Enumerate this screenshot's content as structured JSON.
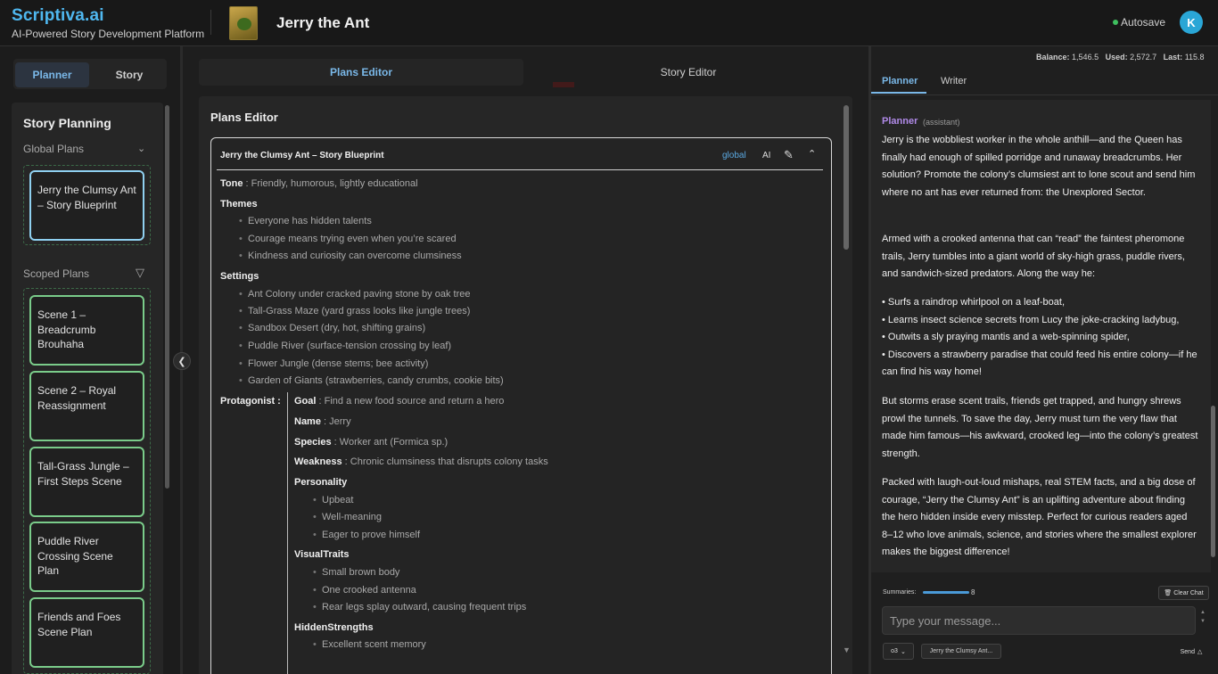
{
  "header": {
    "brand": "Scriptiva.ai",
    "tagline": "AI-Powered Story Development Platform",
    "story_title": "Jerry the Ant",
    "autosave": "Autosave",
    "avatar_initial": "K"
  },
  "left": {
    "tabs": [
      "Planner",
      "Story"
    ],
    "panel_title": "Story Planning",
    "global_label": "Global Plans",
    "global_plans": [
      "Jerry the Clumsy Ant – Story Blueprint"
    ],
    "scoped_label": "Scoped Plans",
    "scoped_plans": [
      "Scene 1 – Breadcrumb Brouhaha",
      "Scene 2 – Royal Reassignment",
      "Tall-Grass Jungle – First Steps Scene",
      "Puddle River Crossing Scene Plan",
      "Friends and Foes Scene Plan"
    ]
  },
  "middle": {
    "tabs": [
      "Plans Editor",
      "Story Editor"
    ],
    "panel_title": "Plans Editor",
    "doc": {
      "title": "Jerry the Clumsy Ant – Story Blueprint",
      "scope_badge": "global",
      "ai_label": "AI",
      "tone_key": "Tone",
      "tone_value": "Friendly, humorous, lightly educational",
      "themes_label": "Themes",
      "themes": [
        "Everyone has hidden talents",
        "Courage means trying even when you’re scared",
        "Kindness and curiosity can overcome clumsiness"
      ],
      "settings_label": "Settings",
      "settings": [
        "Ant Colony under cracked paving stone by oak tree",
        "Tall-Grass Maze (yard grass looks like jungle trees)",
        "Sandbox Desert (dry, hot, shifting grains)",
        "Puddle River (surface-tension crossing by leaf)",
        "Flower Jungle (dense stems; bee activity)",
        "Garden of Giants (strawberries, candy crumbs, cookie bits)"
      ],
      "protagonist_label": "Protagonist :",
      "goal_key": "Goal",
      "goal_value": "Find a new food source and return a hero",
      "name_key": "Name",
      "name_value": "Jerry",
      "species_key": "Species",
      "species_value": "Worker ant (Formica sp.)",
      "weakness_key": "Weakness",
      "weakness_value": "Chronic clumsiness that disrupts colony tasks",
      "personality_label": "Personality",
      "personality": [
        "Upbeat",
        "Well-meaning",
        "Eager to prove himself"
      ],
      "visual_label": "VisualTraits",
      "visual": [
        "Small brown body",
        "One crooked antenna",
        "Rear legs splay outward, causing frequent trips"
      ],
      "hidden_label": "HiddenStrengths",
      "hidden": [
        "Excellent scent memory"
      ]
    }
  },
  "right": {
    "stats": {
      "balance_label": "Balance:",
      "balance": "1,546.5",
      "used_label": "Used:",
      "used": "2,572.7",
      "last_label": "Last:",
      "last": "115.8"
    },
    "tabs": [
      "Planner",
      "Writer"
    ],
    "role": "Planner",
    "role_sub": "(assistant)",
    "paragraphs": [
      "Jerry is the wobbliest worker in the whole anthill—and the Queen has finally had enough of spilled porridge and runaway breadcrumbs. Her solution? Promote the colony’s clumsiest ant to lone scout and send him where no ant has ever returned from: the Unexplored Sector.",
      "Armed with a crooked antenna that can “read” the faintest pheromone trails, Jerry tumbles into a giant world of sky-high grass, puddle rivers, and sandwich-sized predators. Along the way he:",
      "• Surfs a raindrop whirlpool on a leaf-boat,\n• Learns insect science secrets from Lucy the joke-cracking ladybug,\n• Outwits a sly praying mantis and a web-spinning spider,\n• Discovers a strawberry paradise that could feed his entire colony—if he can find his way home!",
      "But storms erase scent trails, friends get trapped, and hungry shrews prowl the tunnels. To save the day, Jerry must turn the very flaw that made him famous—his awkward, crooked leg—into the colony’s greatest strength.",
      "Packed with laugh-out-loud mishaps, real STEM facts, and a big dose of courage, “Jerry the Clumsy Ant” is an uplifting adventure about finding the hero hidden inside every misstep. Perfect for curious readers aged 8–12 who love animals, science, and stories where the smallest explorer makes the biggest difference!"
    ],
    "summaries_label": "Summaries:",
    "summaries_value": "8",
    "clear_chat": "Clear Chat",
    "message_placeholder": "Type your message...",
    "model": "o3",
    "context_chip": "Jerry the Clumsy Ant...",
    "send": "Send"
  },
  "colors": {
    "accent": "#4fb8f0",
    "card_border": "#7acc8a",
    "selected_card_border": "#8fd0f0",
    "role": "#b08ae8"
  }
}
